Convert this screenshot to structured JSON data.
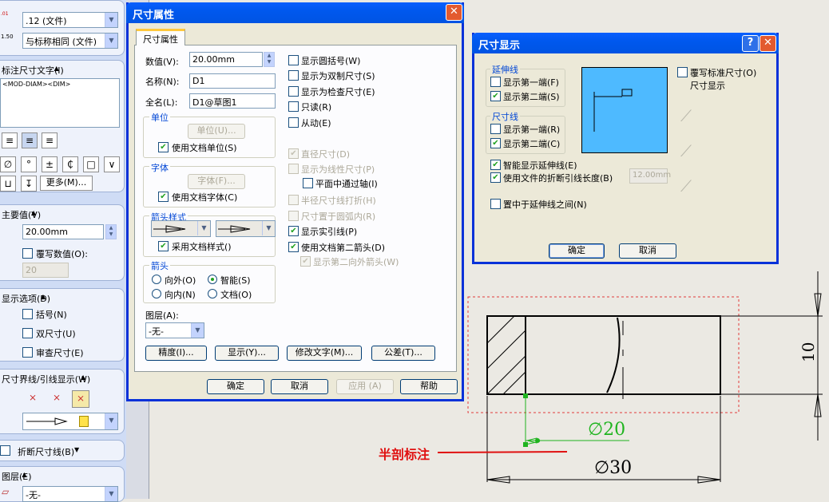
{
  "left_panel": {
    "precision_value": ".12 (文件)",
    "tolerance_value": "与标称相同 (文件)",
    "dim_text_header": "标注尺寸文字(I)",
    "dim_text_value": "<MOD-DIAM><DIM>",
    "more_button": "更多(M)...",
    "primary_value_header": "主要值(V)",
    "primary_value": "20.00mm",
    "override_label": "覆写数值(O):",
    "override_value": "20",
    "display_options_header": "显示选项(D)",
    "opt_parens": "括号(N)",
    "opt_dual": "双尺寸(U)",
    "opt_inspect": "审查尺寸(E)",
    "leader_header": "尺寸界线/引线显示(W)",
    "break_header": "折断尺寸线(B)",
    "layer_header": "图层(E)",
    "layer_value": "-无-",
    "sym_slash": "∅",
    "sym_deg": "°",
    "sym_pm": "±",
    "sym_cl": "₵",
    "sym_box": "□",
    "sym_more": "∨",
    "sym_u": "⊔",
    "sym_depth": "↧",
    "icon_glyph_precision": ".01",
    "icon_glyph_tolerance": "1.50"
  },
  "props_dialog": {
    "title": "尺寸属性",
    "tab": "尺寸属性",
    "value_label": "数值(V):",
    "value": "20.00mm",
    "name_label": "名称(N):",
    "name": "D1",
    "fullname_label": "全名(L):",
    "fullname": "D1@草图1",
    "unit_group": "单位",
    "unit_button": "单位(U)...",
    "use_doc_unit": "使用文档单位(S)",
    "font_group": "字体",
    "font_button": "字体(F)...",
    "use_doc_font": "使用文档字体(C)",
    "arrow_style_group": "箭头样式",
    "use_doc_style": "采用文档样式()",
    "arrow_group": "箭头",
    "arrow_out": "向外(O)",
    "arrow_smart": "智能(S)",
    "arrow_in": "向内(N)",
    "arrow_doc": "文档(O)",
    "layer_label": "图层(A):",
    "layer_value": "-无-",
    "chk_round_paren": "显示圆括号(W)",
    "chk_dual": "显示为双制尺寸(S)",
    "chk_inspect": "显示为检查尺寸(E)",
    "chk_readonly": "只读(R)",
    "chk_driven": "从动(E)",
    "chk_diameter": "直径尺寸(D)",
    "chk_linear": "显示为线性尺寸(P)",
    "chk_plane_axis": "平面中通过轴(I)",
    "chk_half_radius": "半径尺寸线打折(H)",
    "chk_in_arc": "尺寸置于圆弧内(R)",
    "chk_solid_leader": "显示实引线(P)",
    "chk_second_arrow": "使用文档第二箭头(D)",
    "chk_second_out": "显示第二向外箭头(W)",
    "btn_precision": "精度(I)...",
    "btn_display": "显示(Y)...",
    "btn_modify_text": "修改文字(M)...",
    "btn_tolerance": "公差(T)...",
    "btn_ok": "确定",
    "btn_cancel": "取消",
    "btn_apply": "应用 (A)",
    "btn_help": "帮助"
  },
  "display_dialog": {
    "title": "尺寸显示",
    "help_glyph": "?",
    "ext_group": "延伸线",
    "ext_first": "显示第一端(F)",
    "ext_second": "显示第二端(S)",
    "dim_group": "尺寸线",
    "dim_first": "显示第一端(R)",
    "dim_second": "显示第二端(C)",
    "override_std": "覆写标准尺寸(O)",
    "override_std2": "尺寸显示",
    "smart_ext": "智能显示延伸线(E)",
    "use_break_len": "使用文件的折断引线长度(B)",
    "break_len_value": "12.00mm",
    "center_between": "置中于延伸线之间(N)",
    "btn_ok": "确定",
    "btn_cancel": "取消"
  },
  "drawing": {
    "annotation": "半剖标注",
    "dim_20": "∅20",
    "dim_30": "∅30",
    "dim_10": "10",
    "colors": {
      "annotation": "#e01010",
      "green": "#1fb41f",
      "dashed": "#e23b3b"
    }
  }
}
